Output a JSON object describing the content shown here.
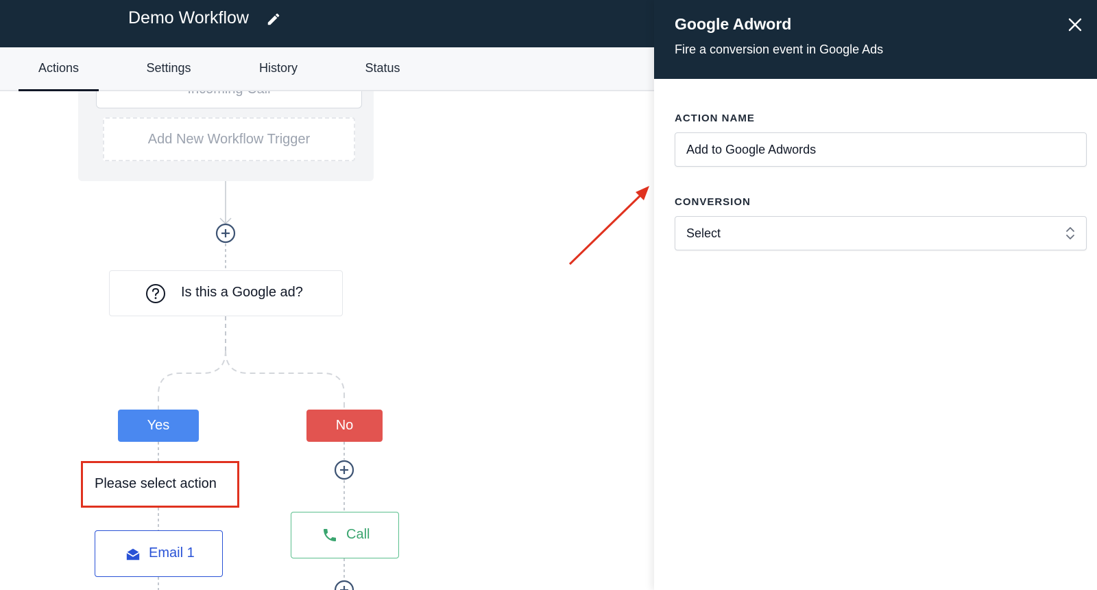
{
  "header": {
    "title": "Demo Workflow"
  },
  "tabs": [
    {
      "label": "Actions",
      "active": true
    },
    {
      "label": "Settings",
      "active": false
    },
    {
      "label": "History",
      "active": false
    },
    {
      "label": "Status",
      "active": false
    }
  ],
  "canvas": {
    "trigger_label": "Incoming Call",
    "add_trigger_label": "Add New Workflow Trigger",
    "condition": {
      "label": "Is this a Google ad?",
      "icon": "question-circle-icon"
    },
    "branches": {
      "yes": {
        "label": "Yes",
        "color": "#4a88f0"
      },
      "no": {
        "label": "No",
        "color": "#e25450"
      }
    },
    "placeholder_action": "Please select action",
    "email_action": {
      "label": "Email 1",
      "icon": "envelope-icon"
    },
    "call_action": {
      "label": "Call",
      "icon": "phone-icon"
    }
  },
  "panel": {
    "title": "Google Adword",
    "subtitle": "Fire a conversion event in Google Ads",
    "action_name": {
      "label": "ACTION NAME",
      "value": "Add to Google Adwords"
    },
    "conversion": {
      "label": "CONVERSION",
      "value": "Select"
    }
  },
  "colors": {
    "header_bg": "#172a3a",
    "highlight_red": "#e0321f",
    "email_blue": "#2952d6",
    "call_green": "#3aa56f"
  }
}
